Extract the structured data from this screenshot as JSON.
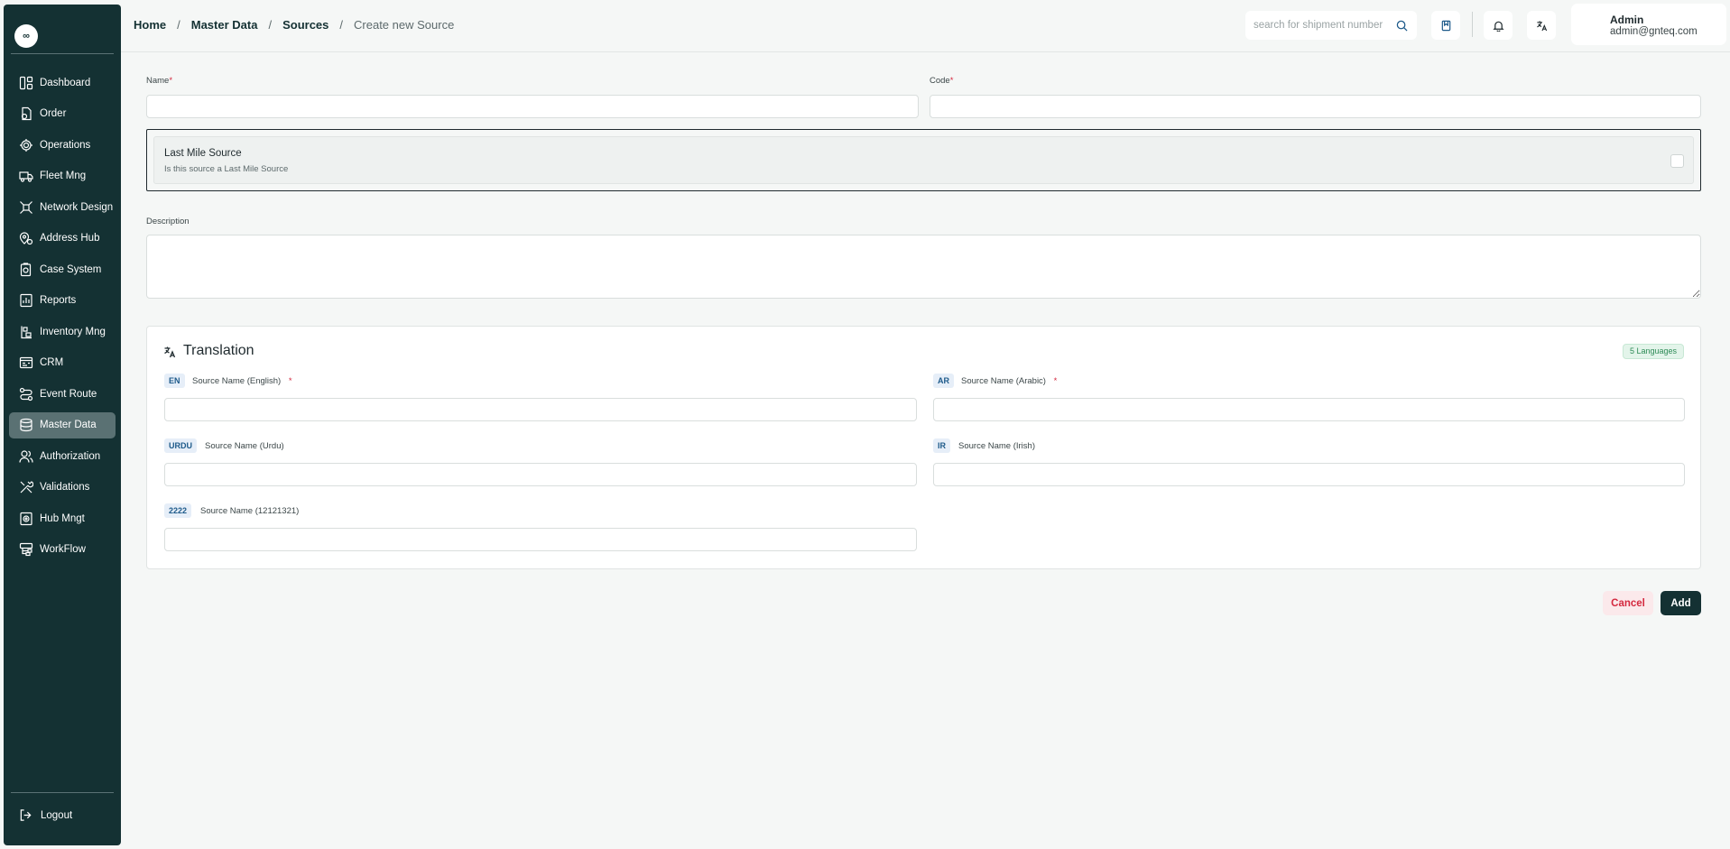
{
  "logo": {
    "text": "∞"
  },
  "sidebar": {
    "items": [
      {
        "label": "Dashboard",
        "icon": "dashboard-icon"
      },
      {
        "label": "Order",
        "icon": "order-icon"
      },
      {
        "label": "Operations",
        "icon": "operations-icon"
      },
      {
        "label": "Fleet Mng",
        "icon": "truck-icon"
      },
      {
        "label": "Network Design",
        "icon": "network-icon"
      },
      {
        "label": "Address Hub",
        "icon": "map-pin-icon"
      },
      {
        "label": "Case System",
        "icon": "case-icon"
      },
      {
        "label": "Reports",
        "icon": "report-icon"
      },
      {
        "label": "Inventory Mng",
        "icon": "inventory-icon"
      },
      {
        "label": "CRM",
        "icon": "crm-icon"
      },
      {
        "label": "Event Route",
        "icon": "route-icon"
      },
      {
        "label": "Master Data",
        "icon": "database-icon"
      },
      {
        "label": "Authorization",
        "icon": "users-icon"
      },
      {
        "label": "Validations",
        "icon": "tools-icon"
      },
      {
        "label": "Hub Mngt",
        "icon": "hub-icon"
      },
      {
        "label": "WorkFlow",
        "icon": "workflow-icon"
      }
    ],
    "active": "Master Data",
    "logout_label": "Logout"
  },
  "header": {
    "breadcrumb": [
      "Home",
      "Master Data",
      "Sources"
    ],
    "breadcrumb_current": "Create new Source",
    "breadcrumb_sep": "/",
    "search_placeholder": "search for shipment number",
    "user_name": "Admin",
    "user_email": "admin@gnteq.com"
  },
  "form": {
    "name_label": "Name",
    "code_label": "Code",
    "required_mark": "*",
    "last_mile_title": "Last Mile Source",
    "last_mile_subtitle": "Is this source a Last Mile Source",
    "description_label": "Description"
  },
  "translation": {
    "title": "Translation",
    "languages_badge": "5 Languages",
    "fields": [
      {
        "code": "EN",
        "label": "Source Name (English)",
        "required": true
      },
      {
        "code": "AR",
        "label": "Source Name (Arabic)",
        "required": true
      },
      {
        "code": "URDU",
        "label": "Source Name (Urdu)",
        "required": false
      },
      {
        "code": "IR",
        "label": "Source Name (Irish)",
        "required": false
      },
      {
        "code": "2222",
        "label": "Source Name (12121321)",
        "required": false
      }
    ]
  },
  "actions": {
    "cancel_label": "Cancel",
    "add_label": "Add"
  },
  "colors": {
    "sidebar_bg": "#143133",
    "active_item_bg": "#5a7173",
    "primary": "#143133",
    "danger": "#d4293f",
    "badge_green": "#2e8b57"
  }
}
